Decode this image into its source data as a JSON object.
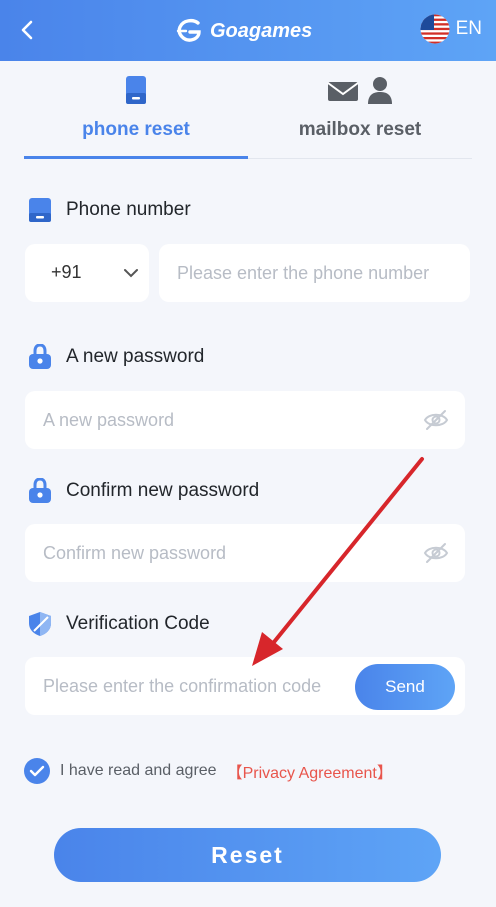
{
  "header": {
    "logo_text": "Goagames",
    "lang": "EN"
  },
  "tabs": [
    {
      "label": "phone reset",
      "active": true
    },
    {
      "label": "mailbox reset",
      "active": false
    }
  ],
  "phone": {
    "label": "Phone number",
    "country_code": "+91",
    "placeholder": "Please enter the phone number"
  },
  "new_password": {
    "label": "A new password",
    "placeholder": "A new password"
  },
  "confirm_password": {
    "label": "Confirm new password",
    "placeholder": "Confirm new password"
  },
  "verification": {
    "label": "Verification Code",
    "placeholder": "Please enter the confirmation code",
    "send_label": "Send"
  },
  "agreement": {
    "text": "I have read and agree",
    "link": "【Privacy Agreement】",
    "checked": true
  },
  "reset_label": "Reset",
  "colors": {
    "accent": "#4a84ea",
    "link": "#e8554c",
    "annotation_arrow": "#d7262b"
  }
}
